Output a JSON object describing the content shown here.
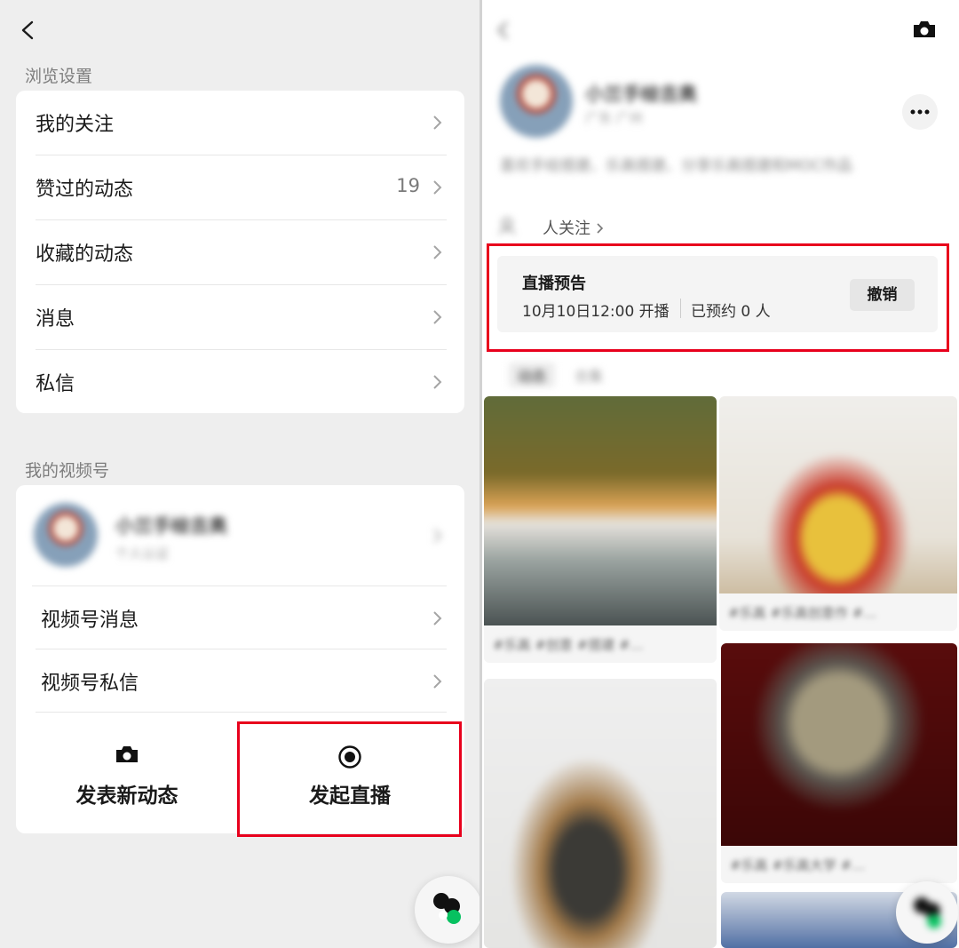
{
  "left": {
    "browse_settings_title": "浏览设置",
    "menu": [
      {
        "label": "我的关注",
        "count": ""
      },
      {
        "label": "赞过的动态",
        "count": "19"
      },
      {
        "label": "收藏的动态",
        "count": ""
      },
      {
        "label": "消息",
        "count": ""
      },
      {
        "label": "私信",
        "count": ""
      }
    ],
    "my_channel_title": "我的视频号",
    "channel": {
      "name": "小兰手绘吉奥",
      "subtitle": "个人认证"
    },
    "channel_menu": [
      {
        "label": "视频号消息"
      },
      {
        "label": "视频号私信"
      }
    ],
    "actions": {
      "post_label": "发表新动态",
      "live_label": "发起直播"
    }
  },
  "right": {
    "profile": {
      "name": "小兰手绘吉奥",
      "subtitle": "广东 广州",
      "bio": "喜欢手绘搭建、乐高搭建、分享乐高搭建和MOC作品",
      "followers_label": "人关注"
    },
    "live_preview": {
      "title": "直播预告",
      "time": "10月10日12:00 开播",
      "reserved": "已预约 0 人",
      "cancel_label": "撤销"
    },
    "tabs": [
      "动态",
      "合集"
    ],
    "tiles": [
      {
        "caption": "#乐高 #创意 #搭建 #…"
      },
      {
        "caption": "#乐高 #乐高创意作 #…"
      },
      {
        "caption": ""
      },
      {
        "caption": "#乐高 #乐高大学 #…"
      }
    ]
  },
  "colors": {
    "highlight": "#e8001c",
    "accent_green": "#07c160"
  }
}
